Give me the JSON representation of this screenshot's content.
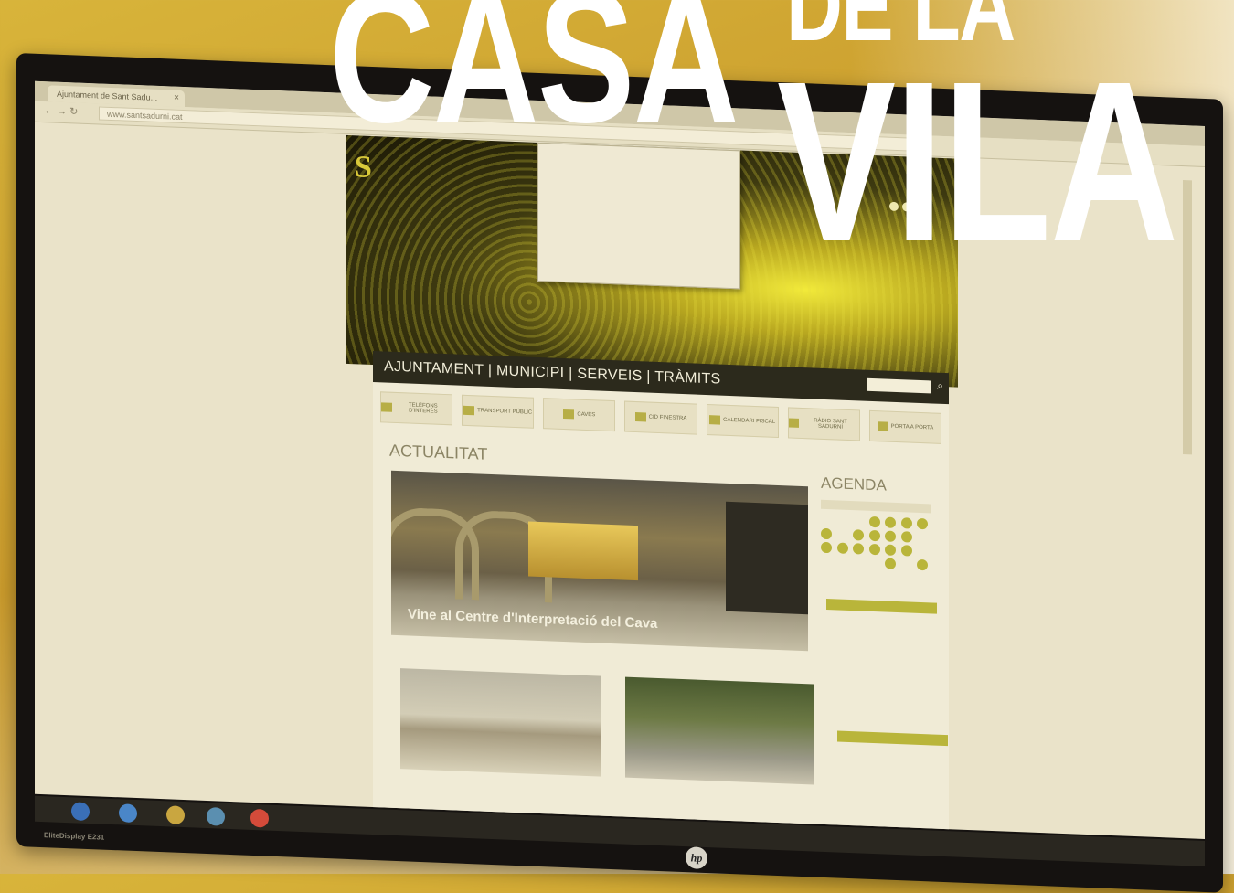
{
  "headline": {
    "casa": "CASA",
    "dela": "DE LA",
    "vila": "VILA"
  },
  "browser": {
    "tab_title": "Ajuntament de Sant Sadu...",
    "url": "www.santsadurni.cat"
  },
  "site": {
    "nav": "AJUNTAMENT | MUNICIPI | SERVEIS | TRÀMITS",
    "quicklinks": [
      "TELÈFONS D'INTERÈS",
      "TRANSPORT PÚBLIC",
      "CAVES",
      "CID FINESTRA",
      "CALENDARI FISCAL",
      "RÀDIO SANT SADURNÍ",
      "PORTA A PORTA"
    ],
    "actualitat": "ACTUALITAT",
    "agenda": "AGENDA",
    "main_caption": "Vine al Centre d'Interpretació del Cava"
  },
  "monitor": {
    "model": "EliteDisplay E231",
    "brand": "hp"
  },
  "colors": {
    "accent": "#b9b53a",
    "nav_bg": "#2c2a1c",
    "headline": "#ffffff"
  }
}
